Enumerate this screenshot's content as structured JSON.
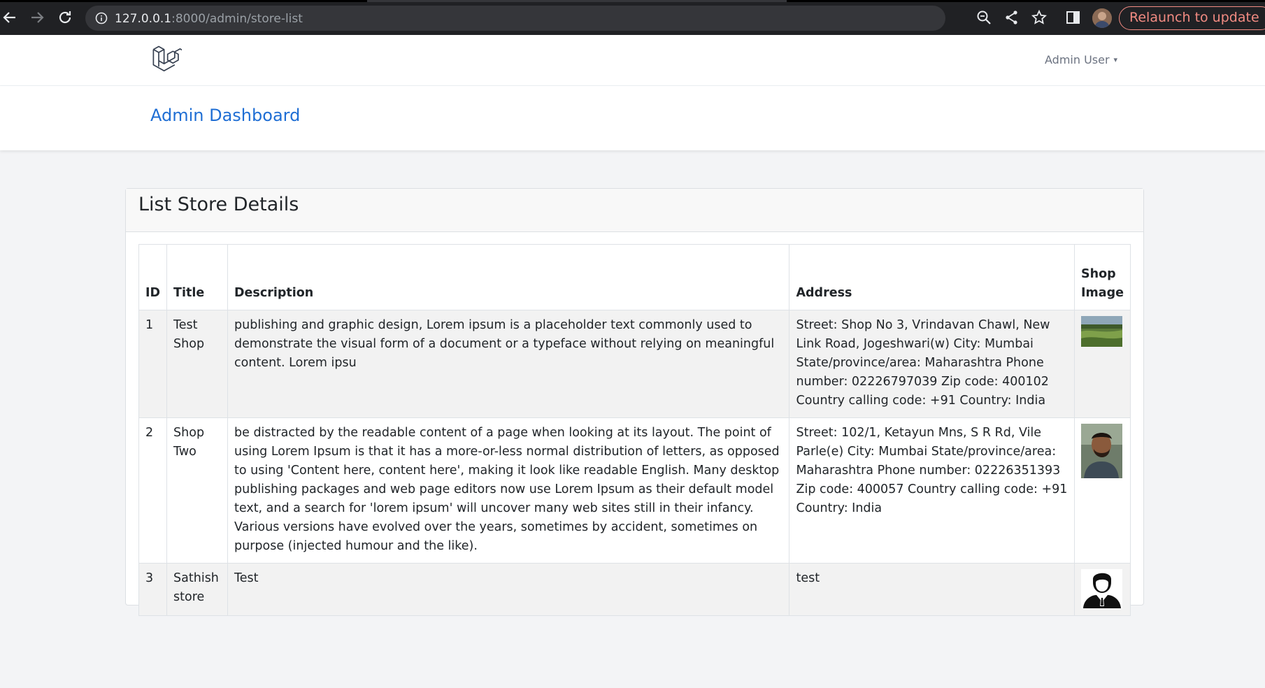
{
  "browser": {
    "url_host": "127.0.0.1",
    "url_path": ":8000/admin/store-list",
    "relaunch_label": "Relaunch to update"
  },
  "appnav": {
    "user_name": "Admin User"
  },
  "header": {
    "title": "Admin Dashboard"
  },
  "card": {
    "title": "List Store Details",
    "columns": [
      "ID",
      "Title",
      "Description",
      "Address",
      "Shop Image"
    ],
    "rows": [
      {
        "id": "1",
        "title": "Test Shop",
        "description": "publishing and graphic design, Lorem ipsum is a placeholder text commonly used to demonstrate the visual form of a document or a typeface without relying on meaningful content. Lorem ipsu",
        "address": "Street: Shop No 3, Vrindavan Chawl, New Link Road, Jogeshwari(w) City: Mumbai State/province/area: Maharashtra Phone number: 02226797039 Zip code: 400102 Country calling code: +91 Country: India",
        "image": "landscape-photo"
      },
      {
        "id": "2",
        "title": "Shop Two",
        "description": "be distracted by the readable content of a page when looking at its layout. The point of using Lorem Ipsum is that it has a more-or-less normal distribution of letters, as opposed to using 'Content here, content here', making it look like readable English. Many desktop publishing packages and web page editors now use Lorem Ipsum as their default model text, and a search for 'lorem ipsum' will uncover many web sites still in their infancy. Various versions have evolved over the years, sometimes by accident, sometimes on purpose (injected humour and the like).",
        "address": "Street: 102/1, Ketayun Mns, S R Rd, Vile Parle(e) City: Mumbai State/province/area: Maharashtra Phone number: 02226351393 Zip code: 400057 Country calling code: +91 Country: India",
        "image": "person-photo"
      },
      {
        "id": "3",
        "title": "Sathish store",
        "description": "Test",
        "address": "test",
        "image": "user-silhouette"
      }
    ]
  },
  "colors": {
    "chrome_bg": "#202124",
    "link_blue": "#1f6ed4",
    "relaunch_red": "#f28b82",
    "page_bg": "#f3f4f6"
  }
}
